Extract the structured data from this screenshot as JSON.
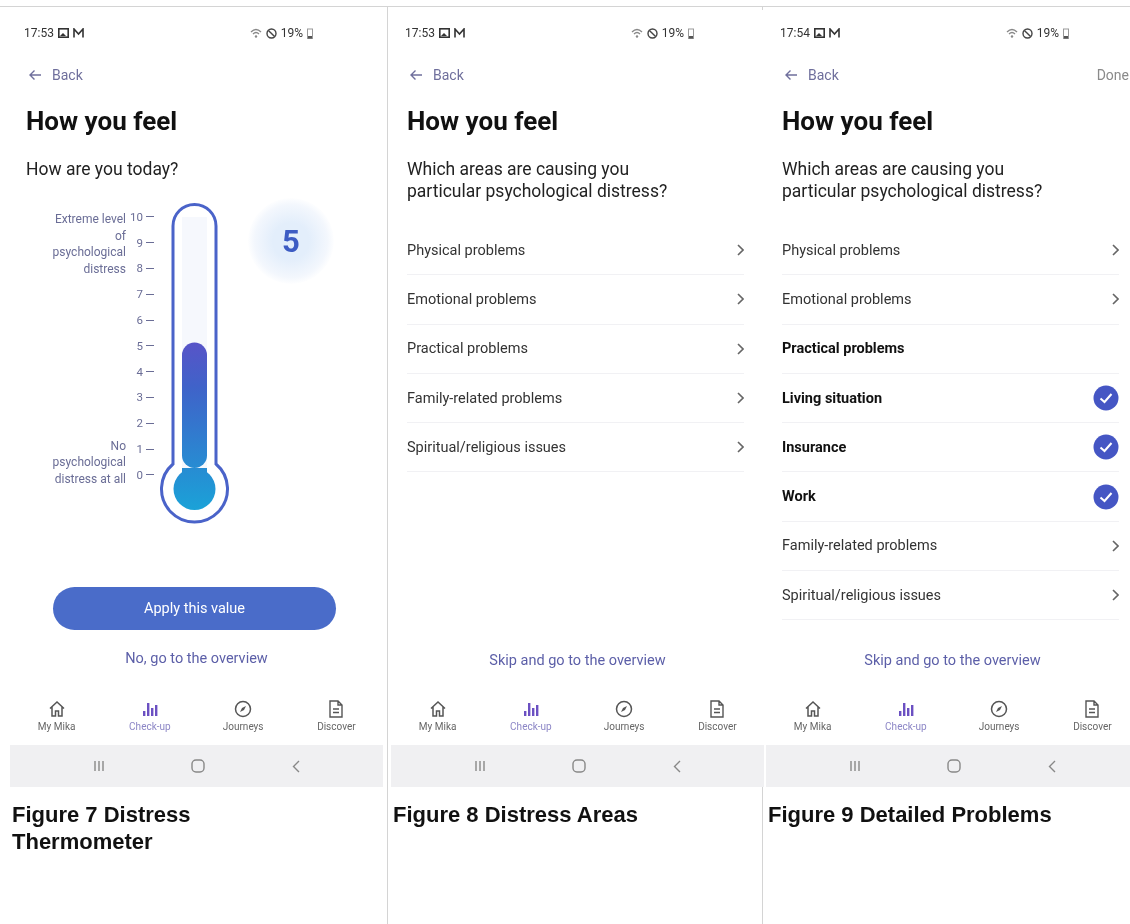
{
  "figures": [
    {
      "caption": "Figure 7 Distress Thermometer",
      "screen": {
        "kind": "thermometer",
        "status_bar": {
          "time": "17:53",
          "battery": "19%"
        },
        "back": "Back",
        "title": "How you feel",
        "question": "How are you today?",
        "scale": [
          "10",
          "9",
          "8",
          "7",
          "6",
          "5",
          "4",
          "3",
          "2",
          "1",
          "0"
        ],
        "top_label": "Extreme level of psychological distress",
        "bottom_label": "No psychological distress at all",
        "level": 0.5,
        "value": "5",
        "button": "Apply this value",
        "link": "No, go to the overview",
        "nav": [
          {
            "label": "My Mika",
            "selected": false
          },
          {
            "label": "Check-up",
            "selected": true
          },
          {
            "label": "Journeys",
            "selected": false
          },
          {
            "label": "Discover",
            "selected": false
          }
        ]
      }
    },
    {
      "caption": "Figure 8 Distress Areas",
      "screen": {
        "kind": "list",
        "status_bar": {
          "time": "17:53",
          "battery": "19%"
        },
        "back": "Back",
        "title": "How you feel",
        "question": "Which areas are causing you particular psychological distress?",
        "items": [
          {
            "kind": "category",
            "label": "Physical problems"
          },
          {
            "kind": "category",
            "label": "Emotional problems"
          },
          {
            "kind": "category",
            "label": "Practical problems"
          },
          {
            "kind": "category",
            "label": "Family-related problems"
          },
          {
            "kind": "category",
            "label": "Spiritual/religious issues"
          }
        ],
        "link": "Skip and go to the overview",
        "nav": [
          {
            "label": "My Mika",
            "selected": false
          },
          {
            "label": "Check-up",
            "selected": true
          },
          {
            "label": "Journeys",
            "selected": false
          },
          {
            "label": "Discover",
            "selected": false
          }
        ]
      }
    },
    {
      "caption": "Figure 9 Detailed Problems",
      "screen": {
        "kind": "list",
        "status_bar": {
          "time": "17:54",
          "battery": "19%"
        },
        "back": "Back",
        "done": "Done",
        "title": "How you feel",
        "question": "Which areas are causing you particular psychological distress?",
        "items": [
          {
            "kind": "category",
            "label": "Physical problems"
          },
          {
            "kind": "category",
            "label": "Emotional problems"
          },
          {
            "kind": "heading",
            "label": "Practical problems"
          },
          {
            "kind": "option",
            "label": "Living situation",
            "checked": true
          },
          {
            "kind": "option",
            "label": "Insurance",
            "checked": true
          },
          {
            "kind": "option",
            "label": "Work",
            "checked": true
          },
          {
            "kind": "category",
            "label": "Family-related problems"
          },
          {
            "kind": "category",
            "label": "Spiritual/religious issues"
          }
        ],
        "link": "Skip and go to the overview",
        "nav": [
          {
            "label": "My Mika",
            "selected": false
          },
          {
            "label": "Check-up",
            "selected": true
          },
          {
            "label": "Journeys",
            "selected": false
          },
          {
            "label": "Discover",
            "selected": false
          }
        ]
      }
    }
  ]
}
